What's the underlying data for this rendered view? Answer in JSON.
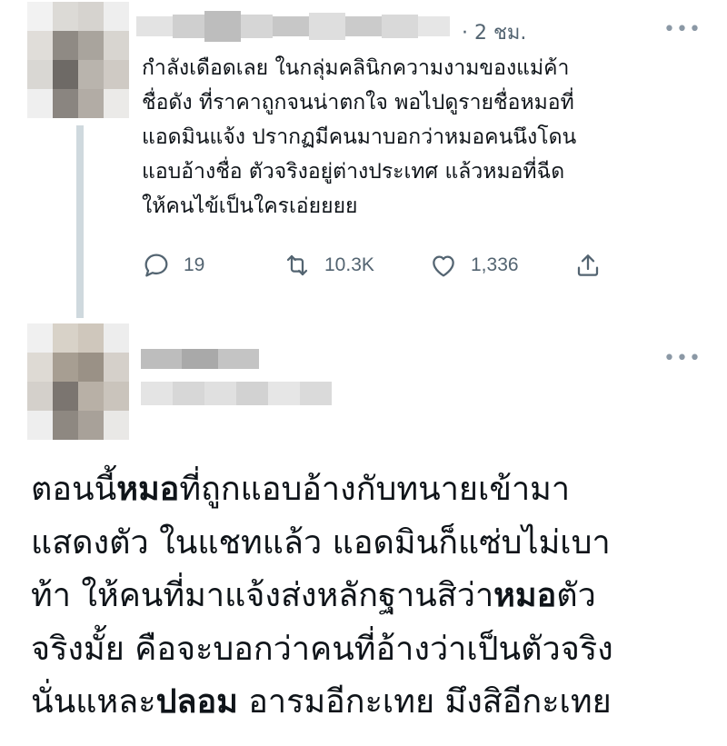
{
  "tweet1": {
    "display_name": "",
    "time_separator": "·",
    "time": "2 ชม.",
    "more_label": "•••",
    "text_lines": [
      "กำลังเดือดเลย ในกลุ่มคลินิกความงามของแม่ค้า",
      "ชื่อดัง ที่ราคาถูกจนน่าตกใจ พอไปดูรายชื่อหมอที่",
      "แอดมินแจ้ง ปรากฏมีคนมาบอกว่าหมอคนนึงโดน",
      "แอบอ้างชื่อ ตัวจริงอยู่ต่างประเทศ แล้วหมอที่ฉีด",
      "ให้คนไข้เป็นใครเอ่ยยยย"
    ],
    "actions": {
      "reply_icon": "reply-icon",
      "reply_count": "19",
      "retweet_icon": "retweet-icon",
      "retweet_count": "10.3K",
      "like_icon": "heart-icon",
      "like_count": "1,336",
      "share_icon": "share-icon"
    }
  },
  "tweet2": {
    "more_label": "•••",
    "lines": [
      {
        "a": "ตอนนี้",
        "b": "หมอ",
        "c": "ที่ถูกแอบอ้างกับทนายเข้ามา"
      },
      {
        "a": "แสดงตัว ในแชทแล้ว แอดมินก็แซ่บไม่เบา",
        "b": "",
        "c": ""
      },
      {
        "a": "ท้า ให้คนที่มาแจ้งส่งหลักฐานสิว่า",
        "b": "หมอ",
        "c": "ตัว"
      },
      {
        "a": "จริงมั้ย คือจะบอกว่าคนที่อ้างว่าเป็นตัวจริง",
        "b": "",
        "c": ""
      },
      {
        "a": "นั่นแหละ",
        "b": "ปลอม",
        "c": " อารมอีกะเทย มึงสิอีกะเทย"
      }
    ]
  },
  "colors": {
    "text": "#0f1419",
    "secondary": "#536471",
    "thread_line": "#cfd9de",
    "blur_gray": "#c9c9c9"
  }
}
